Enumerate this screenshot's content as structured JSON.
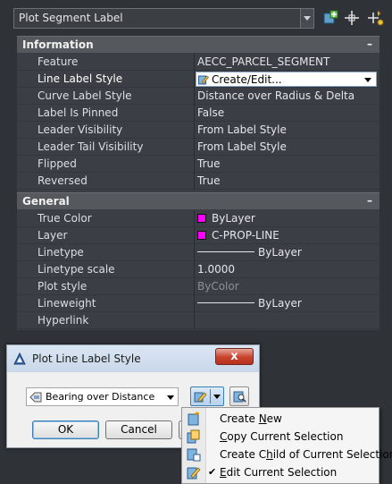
{
  "object_selector": {
    "value": "Plot Segment Label"
  },
  "sections": [
    {
      "title": "Information",
      "collapse": "–",
      "rows": [
        {
          "label": "Feature",
          "value": "AECC_PARCEL_SEGMENT"
        },
        {
          "label": "Line Label Style",
          "value": "Create/Edit..."
        },
        {
          "label": "Curve Label Style",
          "value": "Distance over Radius & Delta"
        },
        {
          "label": "Label Is Pinned",
          "value": "False"
        },
        {
          "label": "Leader Visibility",
          "value": "From Label Style"
        },
        {
          "label": "Leader Tail Visibility",
          "value": "From Label Style"
        },
        {
          "label": "Flipped",
          "value": "True"
        },
        {
          "label": "Reversed",
          "value": "True"
        }
      ]
    },
    {
      "title": "General",
      "collapse": "–",
      "rows": [
        {
          "label": "True Color",
          "value": "ByLayer"
        },
        {
          "label": "Layer",
          "value": "C-PROP-LINE"
        },
        {
          "label": "Linetype",
          "value": "ByLayer"
        },
        {
          "label": "Linetype scale",
          "value": "1.0000"
        },
        {
          "label": "Plot style",
          "value": "ByColor"
        },
        {
          "label": "Lineweight",
          "value": "ByLayer"
        },
        {
          "label": "Hyperlink",
          "value": ""
        }
      ]
    }
  ],
  "dialog": {
    "title": "Plot Line Label Style",
    "close": "x",
    "style_value": "Bearing over Distance",
    "ok": "OK",
    "cancel": "Cancel"
  },
  "menu": {
    "items": [
      {
        "pre": "Create ",
        "key": "N",
        "post": "ew",
        "checked": false
      },
      {
        "pre": "",
        "key": "C",
        "post": "opy Current Selection",
        "checked": false
      },
      {
        "pre": "Create C",
        "key": "h",
        "post": "ild of Current Selection",
        "checked": false
      },
      {
        "pre": "",
        "key": "E",
        "post": "dit Current Selection",
        "checked": true
      }
    ],
    "check_glyph": "✔"
  },
  "colors": {
    "swatch": "#ff00ff",
    "palette_bg": "#3b3f45",
    "header_bg": "#55595e",
    "accent": "#3c7fb1"
  },
  "icons": [
    "add-selection-icon",
    "quick-select-icon",
    "select-objects-icon",
    "style-edit-icon",
    "style-view-icon"
  ]
}
